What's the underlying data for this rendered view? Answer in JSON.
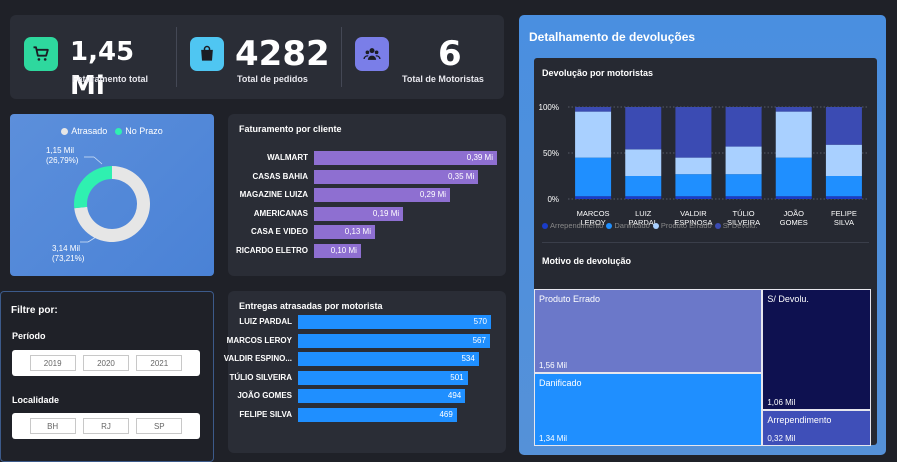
{
  "kpis": [
    {
      "value": "1,45 Mi",
      "label": "Faturamento total",
      "icon": "cart-icon",
      "color": "#2ed89e"
    },
    {
      "value": "4282",
      "label": "Total de pedidos",
      "icon": "bag-icon",
      "color": "#4fc6f2"
    },
    {
      "value": "6",
      "label": "Total de Motoristas",
      "icon": "users-icon",
      "color": "#7a7ee8"
    }
  ],
  "donut": {
    "legend": [
      {
        "name": "Atrasado",
        "color": "#e6e6e6"
      },
      {
        "name": "No Prazo",
        "color": "#2ff0b0"
      }
    ],
    "label_no_prazo": {
      "value": "1,15 Mil",
      "pct": "(26,79%)"
    },
    "label_atrasado": {
      "value": "3,14 Mil",
      "pct": "(73,21%)"
    }
  },
  "filters": {
    "title": "Filtre por:",
    "periodo": {
      "label": "Período",
      "options": [
        "2019",
        "2020",
        "2021"
      ]
    },
    "localidade": {
      "label": "Localidade",
      "options": [
        "BH",
        "RJ",
        "SP"
      ]
    }
  },
  "detalhamento": {
    "title": "Detalhamento de devoluções",
    "stack_title": "Devolução por motoristas",
    "treemap_title": "Motivo de devolução"
  },
  "chart_data": [
    {
      "type": "pie",
      "categories": [
        "Atrasado",
        "No Prazo"
      ],
      "values": [
        3140,
        1150
      ],
      "percent": [
        73.21,
        26.79
      ],
      "colors": [
        "#e6e6e6",
        "#2ff0b0"
      ],
      "legend": "top"
    },
    {
      "type": "bar",
      "orientation": "horizontal",
      "title": "Faturamento por cliente",
      "categories": [
        "WALMART",
        "CASAS BAHIA",
        "MAGAZINE LUIZA",
        "AMERICANAS",
        "CASA E VIDEO",
        "RICARDO ELETRO"
      ],
      "values": [
        0.39,
        0.35,
        0.29,
        0.19,
        0.13,
        0.1
      ],
      "value_labels": [
        "0,39 Mi",
        "0,35 Mi",
        "0,29 Mi",
        "0,19 Mi",
        "0,13 Mi",
        "0,10 Mi"
      ],
      "color": "#8e6fd1"
    },
    {
      "type": "bar",
      "orientation": "horizontal",
      "title": "Entregas atrasadas por motorista",
      "categories": [
        "LUIZ PARDAL",
        "MARCOS LEROY",
        "VALDIR ESPINO...",
        "TÚLIO SILVEIRA",
        "JOÃO GOMES",
        "FELIPE SILVA"
      ],
      "values": [
        570,
        567,
        534,
        501,
        494,
        469
      ],
      "color": "#1f8fff"
    },
    {
      "type": "bar",
      "stacked": "percent",
      "title": "Devolução por motoristas",
      "categories": [
        "MARCOS LEROY",
        "LUIZ PARDAL",
        "VALDIR ESPINOSA",
        "TÚLIO SILVEIRA",
        "JOÃO GOMES",
        "FELIPE SILVA"
      ],
      "yticks": [
        "0%",
        "50%",
        "100%"
      ],
      "series": [
        {
          "name": "Arrependimento",
          "color": "#1a3cc9",
          "values": [
            3,
            3,
            3,
            3,
            3,
            3
          ]
        },
        {
          "name": "Danificado",
          "color": "#1f8fff",
          "values": [
            42,
            22,
            24,
            24,
            42,
            22
          ]
        },
        {
          "name": "Produto Errado",
          "color": "#a9d0ff",
          "values": [
            50,
            29,
            18,
            30,
            50,
            34
          ]
        },
        {
          "name": "S/ Devolu.",
          "color": "#3b4bb3",
          "values": [
            5,
            46,
            55,
            43,
            5,
            41
          ]
        }
      ],
      "legend": "bottom"
    },
    {
      "type": "treemap",
      "title": "Motivo de devolução",
      "items": [
        {
          "name": "Produto Errado",
          "label": "1,56 Mil",
          "value": 1560,
          "color": "#6b78c9"
        },
        {
          "name": "Danificado",
          "label": "1,34 Mil",
          "value": 1340,
          "color": "#1f8fff"
        },
        {
          "name": "S/ Devolu.",
          "label": "1,06 Mil",
          "value": 1060,
          "color": "#0e1150"
        },
        {
          "name": "Arrependimento",
          "label": "0,32 Mil",
          "value": 320,
          "color": "#3f4fb8"
        }
      ]
    }
  ]
}
